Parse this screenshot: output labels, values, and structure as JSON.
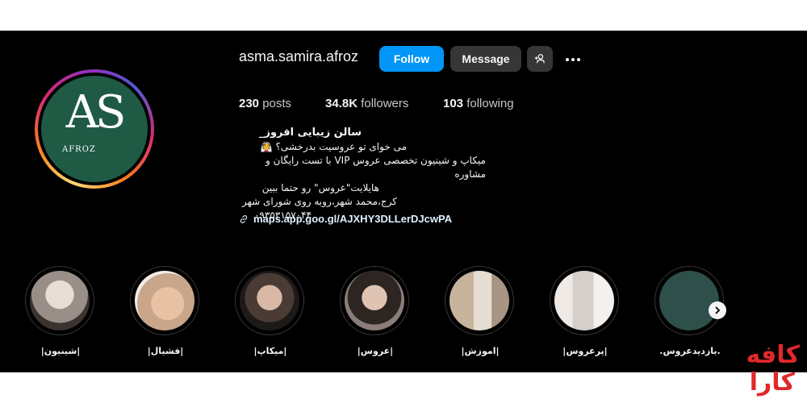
{
  "profile": {
    "username": "asma.samira.afroz",
    "follow_label": "Follow",
    "message_label": "Message",
    "add_user_icon": "person-add-icon",
    "more_icon": "more-options-icon",
    "avatar_letters": "AS",
    "avatar_sub": "AFROZ",
    "avatar_color": "#1f5a45"
  },
  "stats": {
    "posts_count": "230",
    "posts_label": "posts",
    "followers_count": "34.8K",
    "followers_label": "followers",
    "following_count": "103",
    "following_label": "following"
  },
  "bio": {
    "name": "سالن زیبایی افروز_",
    "lines": [
      "می خوای تو عروسیت بدرخشی؟ 👰",
      "میکاپ و شینیون تخصصی عروس VIP با تست رایگان و مشاوره",
      "هایلایت\"عروس\" رو حتما ببین",
      "کرج،محمد شهر،روبه روی شورای شهر",
      "۰۹۳۵۳۱۵۷۰۴۴"
    ],
    "link": "maps.app.goo.gl/AJXHY3DLLerDJcwPA"
  },
  "highlights": [
    {
      "label": "|شینیون|",
      "color": "#9a8f88"
    },
    {
      "label": "|فشیال|",
      "color": "#c9a58a"
    },
    {
      "label": "|میکاپ|",
      "color": "#7a6a66"
    },
    {
      "label": "|عروس|",
      "color": "#8b7e7a"
    },
    {
      "label": "|اموزش|",
      "color": "#a89482"
    },
    {
      "label": "|پرعروس|",
      "color": "#d4cfcb"
    },
    {
      "label": ".بازدیدعروس.",
      "color": "#2e4f4a"
    }
  ],
  "watermark": {
    "top": "کافه",
    "bottom": "کارا",
    "color": "#e0282b"
  }
}
